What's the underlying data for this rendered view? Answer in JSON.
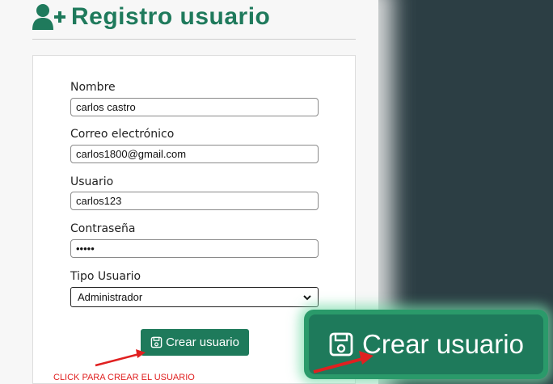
{
  "header": {
    "icon": "user-plus-icon",
    "title": "Registro usuario"
  },
  "form": {
    "nombre": {
      "label": "Nombre",
      "value": "carlos castro"
    },
    "correo": {
      "label": "Correo electrónico",
      "value": "carlos1800@gmail.com"
    },
    "usuario": {
      "label": "Usuario",
      "value": "carlos123"
    },
    "contrasena": {
      "label": "Contraseña",
      "value": "•••••"
    },
    "tipo": {
      "label": "Tipo Usuario",
      "selected": "Administrador"
    },
    "submit": {
      "icon": "save-icon",
      "label": "Crear usuario"
    }
  },
  "annotation": {
    "hint": "CLICK PARA CREAR EL USUARIO",
    "zoom_label": "Crear usuario",
    "arrow_color": "#e02020"
  },
  "colors": {
    "accent": "#1e7a5b",
    "background": "#2c3e44"
  }
}
